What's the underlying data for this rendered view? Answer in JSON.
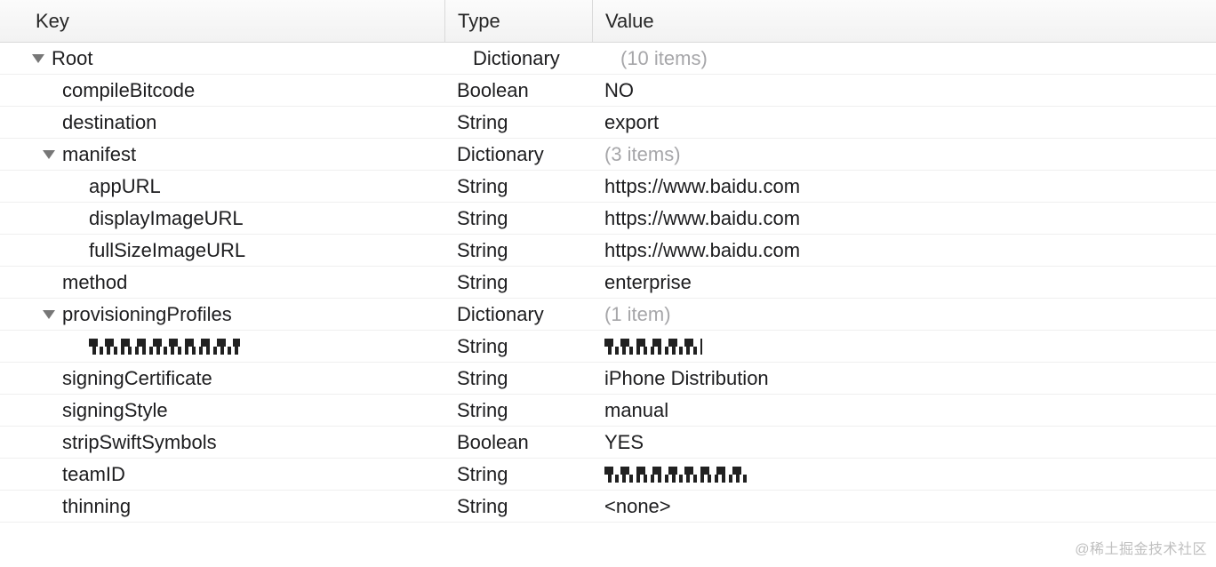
{
  "columns": {
    "key": "Key",
    "type": "Type",
    "value": "Value"
  },
  "rows": [
    {
      "indent": 0,
      "expandable": true,
      "key": "Root",
      "type": "Dictionary",
      "value": "(10 items)",
      "placeholder": true,
      "redactedKey": false,
      "redactedVal": false
    },
    {
      "indent": 1,
      "expandable": false,
      "key": "compileBitcode",
      "type": "Boolean",
      "value": "NO",
      "placeholder": false,
      "redactedKey": false,
      "redactedVal": false
    },
    {
      "indent": 1,
      "expandable": false,
      "key": "destination",
      "type": "String",
      "value": "export",
      "placeholder": false,
      "redactedKey": false,
      "redactedVal": false
    },
    {
      "indent": 1,
      "expandable": true,
      "key": "manifest",
      "type": "Dictionary",
      "value": "(3 items)",
      "placeholder": true,
      "redactedKey": false,
      "redactedVal": false
    },
    {
      "indent": 2,
      "expandable": false,
      "key": "appURL",
      "type": "String",
      "value": "https://www.baidu.com",
      "placeholder": false,
      "redactedKey": false,
      "redactedVal": false
    },
    {
      "indent": 2,
      "expandable": false,
      "key": "displayImageURL",
      "type": "String",
      "value": "https://www.baidu.com",
      "placeholder": false,
      "redactedKey": false,
      "redactedVal": false
    },
    {
      "indent": 2,
      "expandable": false,
      "key": "fullSizeImageURL",
      "type": "String",
      "value": "https://www.baidu.com",
      "placeholder": false,
      "redactedKey": false,
      "redactedVal": false
    },
    {
      "indent": 1,
      "expandable": false,
      "key": "method",
      "type": "String",
      "value": "enterprise",
      "placeholder": false,
      "redactedKey": false,
      "redactedVal": false
    },
    {
      "indent": 1,
      "expandable": true,
      "key": "provisioningProfiles",
      "type": "Dictionary",
      "value": "(1 item)",
      "placeholder": true,
      "redactedKey": false,
      "redactedVal": false
    },
    {
      "indent": 2,
      "expandable": false,
      "key": "",
      "type": "String",
      "value": "",
      "placeholder": false,
      "redactedKey": true,
      "redactedVal": true,
      "redactValClass": "pixel-val-a"
    },
    {
      "indent": 1,
      "expandable": false,
      "key": "signingCertificate",
      "type": "String",
      "value": "iPhone Distribution",
      "placeholder": false,
      "redactedKey": false,
      "redactedVal": false
    },
    {
      "indent": 1,
      "expandable": false,
      "key": "signingStyle",
      "type": "String",
      "value": "manual",
      "placeholder": false,
      "redactedKey": false,
      "redactedVal": false
    },
    {
      "indent": 1,
      "expandable": false,
      "key": "stripSwiftSymbols",
      "type": "Boolean",
      "value": "YES",
      "placeholder": false,
      "redactedKey": false,
      "redactedVal": false
    },
    {
      "indent": 1,
      "expandable": false,
      "key": "teamID",
      "type": "String",
      "value": "",
      "placeholder": false,
      "redactedKey": false,
      "redactedVal": true,
      "redactValClass": "pixel-val-b"
    },
    {
      "indent": 1,
      "expandable": false,
      "key": "thinning",
      "type": "String",
      "value": "<none>",
      "placeholder": false,
      "redactedKey": false,
      "redactedVal": false
    }
  ],
  "watermark": "@稀土掘金技术社区"
}
